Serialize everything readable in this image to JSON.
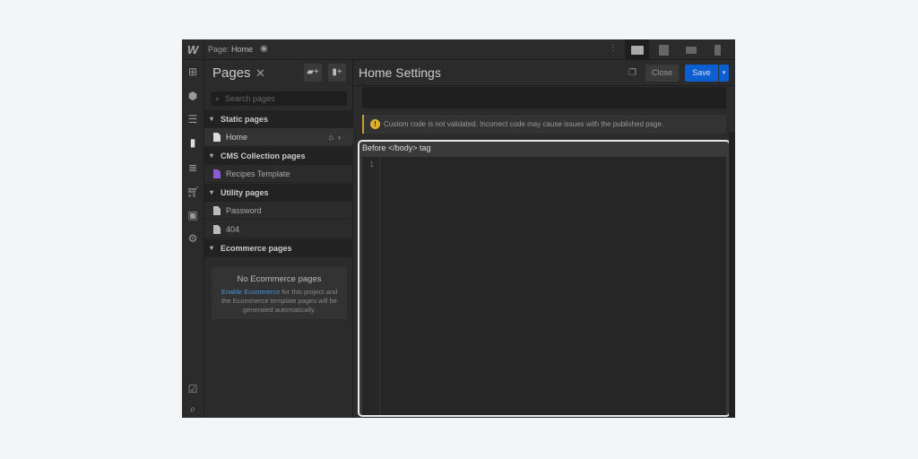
{
  "topbar": {
    "logo": "W",
    "page_prefix": "Page:",
    "page_name": "Home"
  },
  "pages_panel": {
    "title": "Pages",
    "search_placeholder": "Search pages",
    "sections": [
      {
        "label": "Static pages",
        "items": [
          {
            "label": "Home"
          }
        ]
      },
      {
        "label": "CMS Collection pages",
        "items": [
          {
            "label": "Recipes Template"
          }
        ]
      },
      {
        "label": "Utility pages",
        "items": [
          {
            "label": "Password"
          },
          {
            "label": "404"
          }
        ]
      },
      {
        "label": "Ecommerce pages",
        "items": []
      }
    ],
    "ecommerce_empty": {
      "title": "No Ecommerce pages",
      "link": "Enable Ecommerce",
      "text": " for this project and the Ecommerce template pages will be generated automatically."
    }
  },
  "settings": {
    "title": "Home Settings",
    "close_label": "Close",
    "save_label": "Save",
    "warning": "Custom code is not validated. Incorrect code may cause issues with the published page.",
    "editor_label": "Before </body> tag",
    "line_number": "1"
  },
  "colors": {
    "accent": "#0b5fd0",
    "warning": "#e0b02a",
    "cms": "#8b5cd6"
  }
}
